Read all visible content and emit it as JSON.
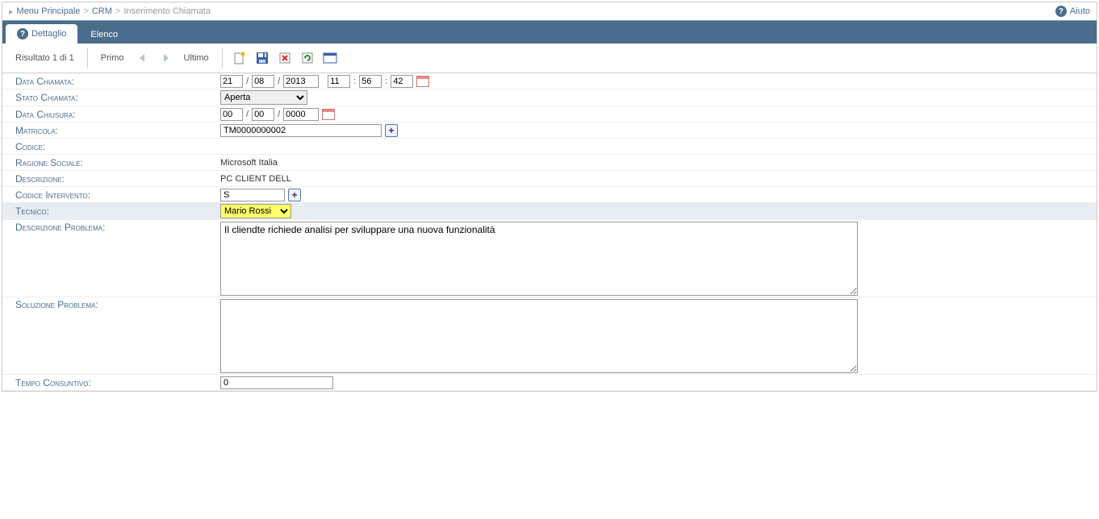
{
  "breadcrumb": {
    "items": [
      "Menu Principale",
      "CRM",
      "Inserimento Chiamata"
    ],
    "help_label": "Aiuto"
  },
  "tabs": {
    "detail": "Dettaglio",
    "list": "Elenco"
  },
  "toolbar": {
    "result": "Risultato 1 di 1",
    "first": "Primo",
    "last": "Ultimo"
  },
  "labels": {
    "data_chiamata": "Data Chiamata:",
    "stato_chiamata": "Stato Chiamata:",
    "data_chiusura": "Data Chiusura:",
    "matricola": "Matricola:",
    "codice": "Codice:",
    "ragione_sociale": "Ragione Sociale:",
    "descrizione": "Descrizione:",
    "codice_intervento": "Codice Intervento:",
    "tecnico": "Tecnico:",
    "descrizione_problema": "Descrizione Problema:",
    "soluzione_problema": "Soluzione Problema:",
    "tempo_consuntivo": "Tempo Consuntivo:"
  },
  "values": {
    "date_day": "21",
    "date_month": "08",
    "date_year": "2013",
    "time_h": "11",
    "time_m": "56",
    "time_s": "42",
    "stato": "Aperta",
    "close_day": "00",
    "close_month": "00",
    "close_year": "0000",
    "matricola": "TM0000000002",
    "codice": "",
    "ragione_sociale": "Microsoft Italia",
    "descrizione": "PC CLIENT DELL",
    "codice_intervento": "S",
    "tecnico": "Mario Rossi",
    "descrizione_problema": "Il cliendte richiede analisi per sviluppare una nuova funzionalità",
    "soluzione_problema": "",
    "tempo_consuntivo": "0"
  }
}
